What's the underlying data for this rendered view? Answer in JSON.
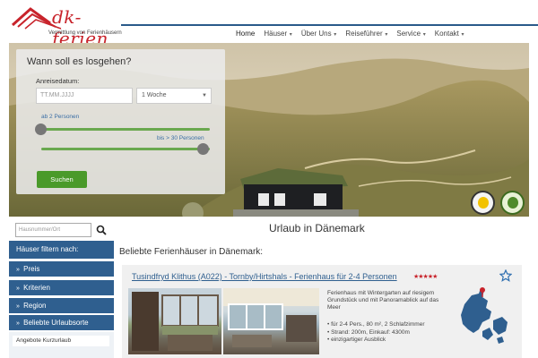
{
  "logo": {
    "brand": "dk-ferien",
    "tagline": "Vermittlung von Ferienhäusern"
  },
  "nav": [
    {
      "label": "Home",
      "dropdown": false
    },
    {
      "label": "Häuser",
      "dropdown": true
    },
    {
      "label": "Über Uns",
      "dropdown": true
    },
    {
      "label": "Reiseführer",
      "dropdown": true
    },
    {
      "label": "Service",
      "dropdown": true
    },
    {
      "label": "Kontakt",
      "dropdown": true
    }
  ],
  "search": {
    "title": "Wann soll es losgehen?",
    "arrival_label": "Anreisedatum:",
    "date_placeholder": "TT.MM.JJJJ",
    "duration_value": "1 Woche",
    "min_persons_label": "ab 2 Personen",
    "max_persons_label": "bis > 30 Personen",
    "min_persons": 2,
    "max_persons": 30,
    "button_label": "Suchen"
  },
  "sidebar": {
    "search_placeholder": "Hausnummer/Ort",
    "filter_heading": "Häuser filtern nach:",
    "items": [
      {
        "label": "Preis"
      },
      {
        "label": "Kriterien"
      },
      {
        "label": "Region"
      },
      {
        "label": "Beliebte Urlaubsorte"
      }
    ],
    "sub_item": "Angebote Kurzurlaub"
  },
  "main": {
    "page_title": "Urlaub in Dänemark",
    "section_title": "Beliebte Ferienhäuser in Dänemark:",
    "listing": {
      "title": "Tusindfryd Klithus (A022) - Tornby/Hirtshals - Ferienhaus für 2-4 Personen",
      "stars": "★★★★★",
      "rating": 5,
      "description": "Ferienhaus mit Wintergarten auf riesigem Grundstück und mit Panoramablick auf das Meer",
      "bullets": [
        "für 2-4 Pers., 80 m², 2 Schlafzimmer",
        "Strand: 200m, Einkauf: 4300m",
        "einzigartiger Ausblick"
      ]
    }
  },
  "colors": {
    "brand_red": "#c8232b",
    "nav_blue": "#2f5f8f",
    "green_button": "#4a9a2a",
    "slider_green": "#6aa84f"
  }
}
